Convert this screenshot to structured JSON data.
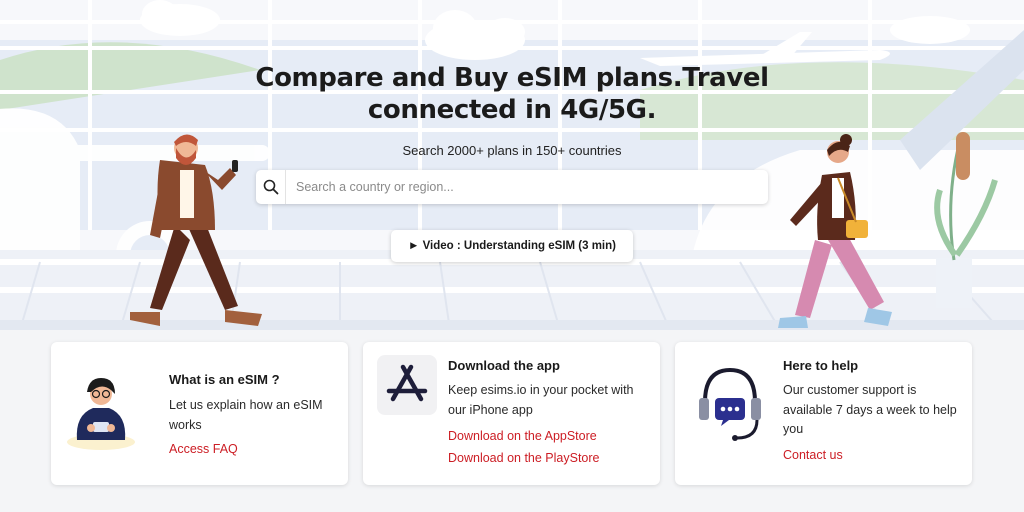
{
  "hero": {
    "headline_line1": "Compare and Buy eSIM plans.Travel",
    "headline_line2": "connected in 4G/5G.",
    "subline": "Search 2000+ plans in 150+ countries",
    "search_placeholder": "Search a country or region...",
    "video_button": "► Video : Understanding eSIM (3 min)"
  },
  "cards": [
    {
      "title": "What is an eSIM ?",
      "body": "Let us explain how an eSIM works",
      "links": [
        "Access FAQ"
      ]
    },
    {
      "title": "Download the app",
      "body": "Keep esims.io in your pocket with our iPhone app",
      "links": [
        "Download on the AppStore",
        "Download on the PlayStore"
      ],
      "icon": "app-store-icon"
    },
    {
      "title": "Here to help",
      "body": "Our customer support is available 7 days a week to help you",
      "links": [
        "Contact us"
      ],
      "icon": "headset-support-icon"
    }
  ],
  "colors": {
    "link": "#cc1d24",
    "hero_sky": "#dfe6f4",
    "hero_green": "#cfe3cc"
  }
}
